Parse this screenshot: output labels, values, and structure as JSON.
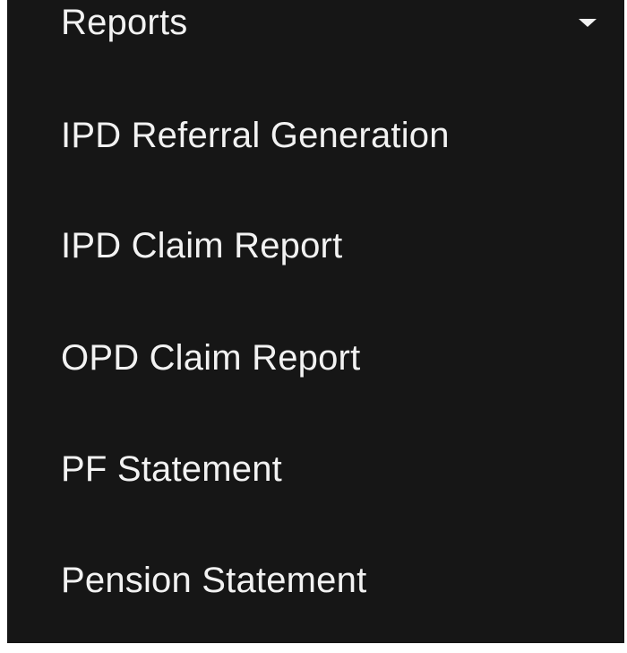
{
  "menu": {
    "header_label": "Reports",
    "header_icon": "caret-down-icon",
    "items": [
      {
        "label": "IPD Referral Generation"
      },
      {
        "label": "IPD Claim Report"
      },
      {
        "label": "OPD Claim Report"
      },
      {
        "label": "PF Statement"
      },
      {
        "label": "Pension Statement"
      }
    ]
  },
  "colors": {
    "panel_background": "#161616",
    "text": "#f2f2f2",
    "page_background": "#ffffff"
  }
}
